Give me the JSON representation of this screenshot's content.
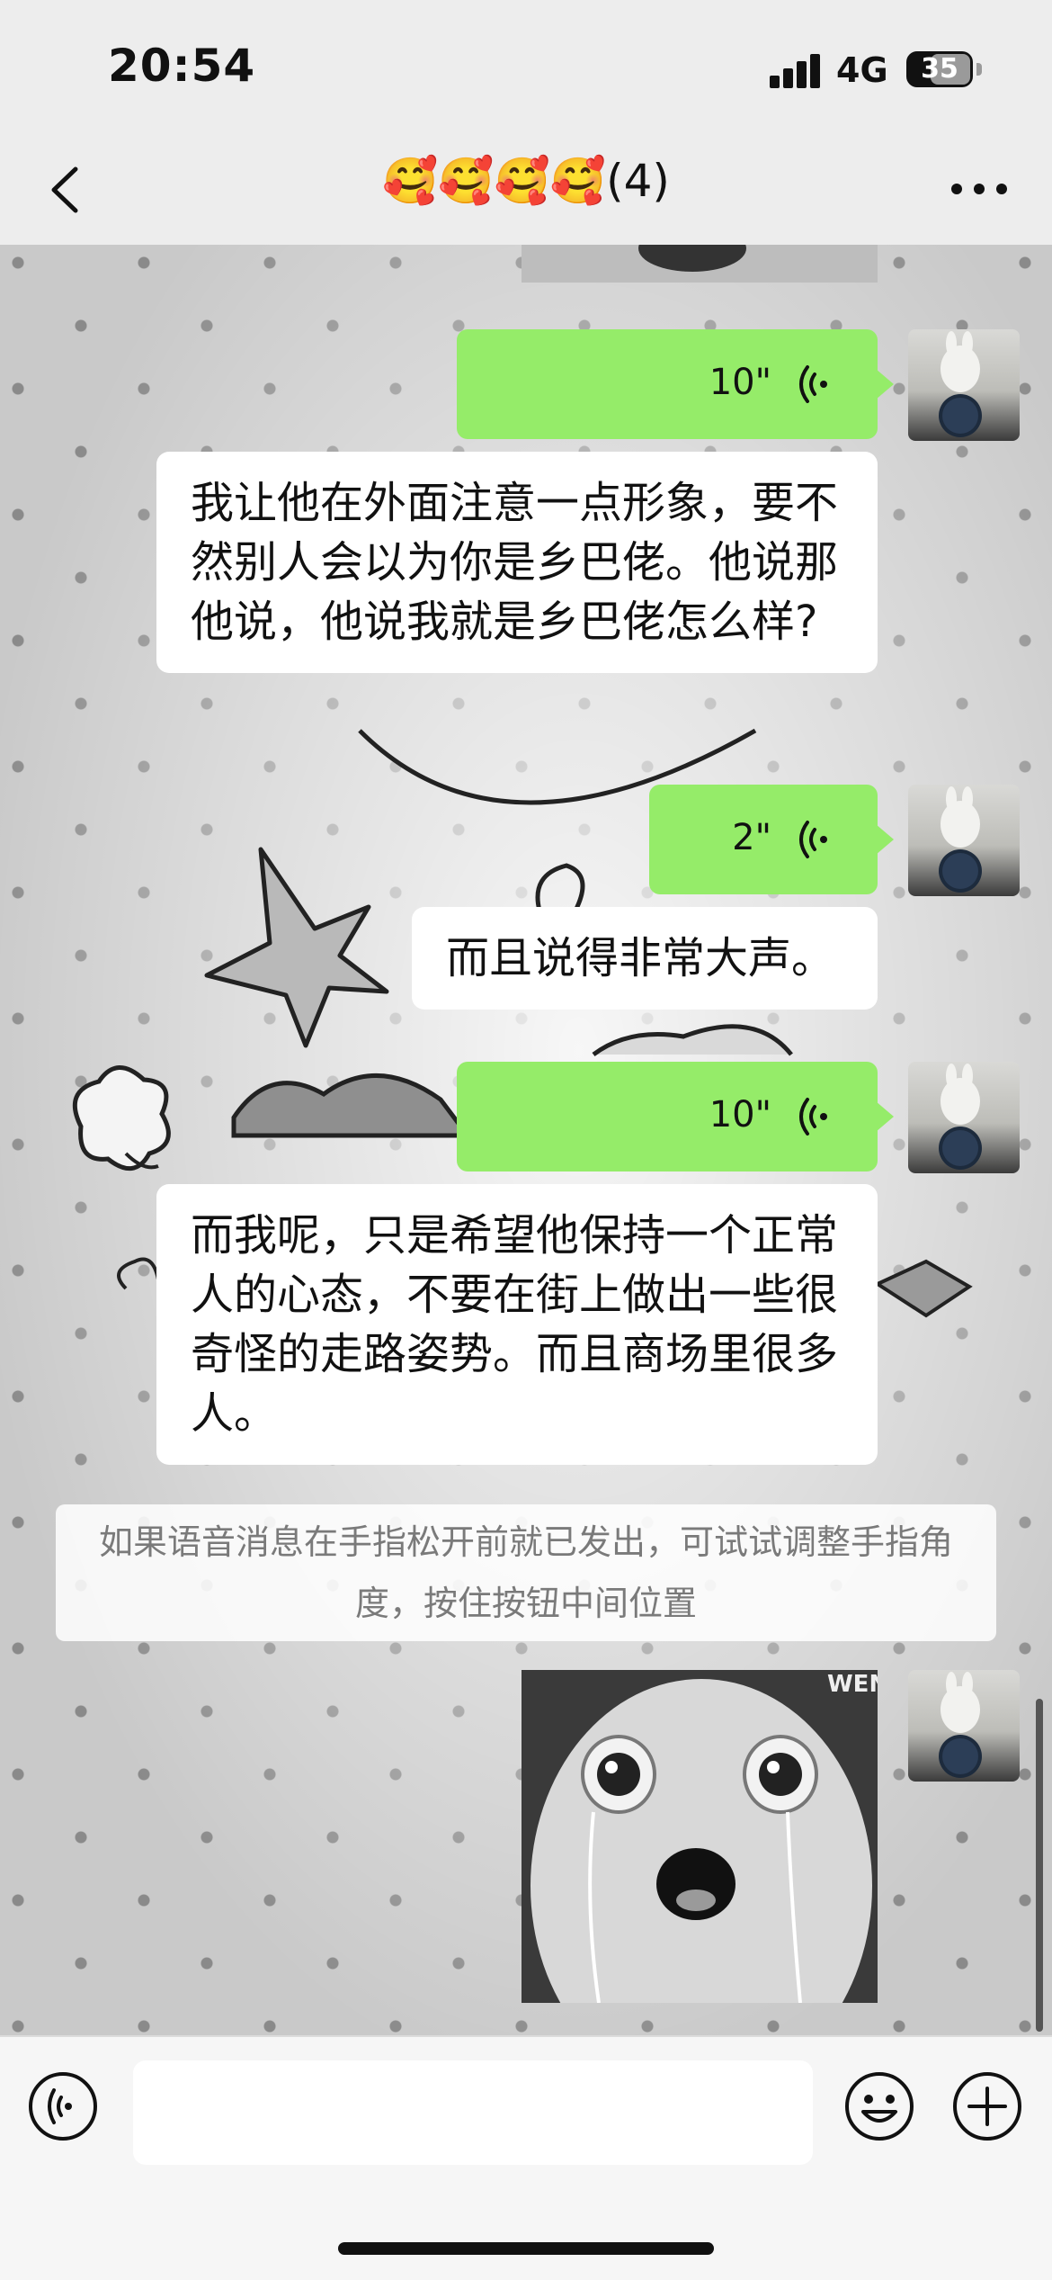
{
  "status_bar": {
    "time": "20:54",
    "network": "4G",
    "battery": "35"
  },
  "nav": {
    "title": "🥰🥰🥰🥰(4)",
    "back_icon": "chevron-left-icon",
    "more_icon": "more-dots-icon"
  },
  "messages": [
    {
      "type": "voice",
      "duration": "10\"",
      "transcript": "我让他在外面注意一点形象，要不然别人会以为你是乡巴佬。他说那他说，他说我就是乡巴佬怎么样?"
    },
    {
      "type": "voice",
      "duration": "2\"",
      "transcript": "而且说得非常大声。"
    },
    {
      "type": "voice",
      "duration": "10\"",
      "transcript": "而我呢，只是希望他保持一个正常人的心态，不要在街上做出一些很奇怪的走路姿势。而且商场里很多人。"
    }
  ],
  "system_tip": "如果语音消息在手指松开前就已发出，可试试调整手指角度，按住按钮中间位置",
  "sticker": {
    "watermark": "WEN"
  },
  "input_bar": {
    "input_value": "",
    "voice_icon": "voice-input-icon",
    "emoji_icon": "emoji-icon",
    "plus_icon": "plus-icon"
  },
  "colors": {
    "bubble_self": "#95ec69",
    "bubble_transcript": "#ffffff",
    "background": "#ededed"
  }
}
